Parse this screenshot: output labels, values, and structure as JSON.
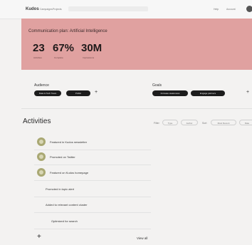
{
  "topbar": {
    "logo": "Kudos",
    "nav": [
      "Campaigns",
      "Projects"
    ],
    "right": [
      "Help",
      "Account"
    ]
  },
  "hero": {
    "title": "Communication plan: Artificial Intelligence",
    "stats": [
      {
        "value": "23",
        "label": "Activities"
      },
      {
        "value": "67%",
        "label": "Complete"
      },
      {
        "value": "30M",
        "label": "Impressions"
      }
    ]
  },
  "audience": {
    "label": "Audience",
    "pills": [
      "Data & Tech Team",
      "Public"
    ],
    "add": "+"
  },
  "goals": {
    "label": "Goals",
    "pills": [
      "Increase awareness",
      "Engage partners"
    ],
    "add": "+"
  },
  "activities": {
    "title": "Activities",
    "filter_label": "Filter",
    "filter_chips": [
      "Type",
      "Author"
    ],
    "sort_label": "Sort",
    "sort_chips": [
      "Most Recent",
      "Date"
    ],
    "items": [
      {
        "text": "Featured in Kudos newsletter",
        "icon": "badge-icon"
      },
      {
        "text": "Promoted on Twitter",
        "icon": "badge-icon"
      },
      {
        "text": "Featured on Kudos homepage",
        "icon": "badge-icon"
      },
      {
        "text": "Promoted in topic alert",
        "icon": null
      },
      {
        "text": "Added to relevant content cluster",
        "icon": null
      },
      {
        "text": "Optimized for search",
        "icon": null
      }
    ],
    "add": "+",
    "view_all": "View all"
  }
}
